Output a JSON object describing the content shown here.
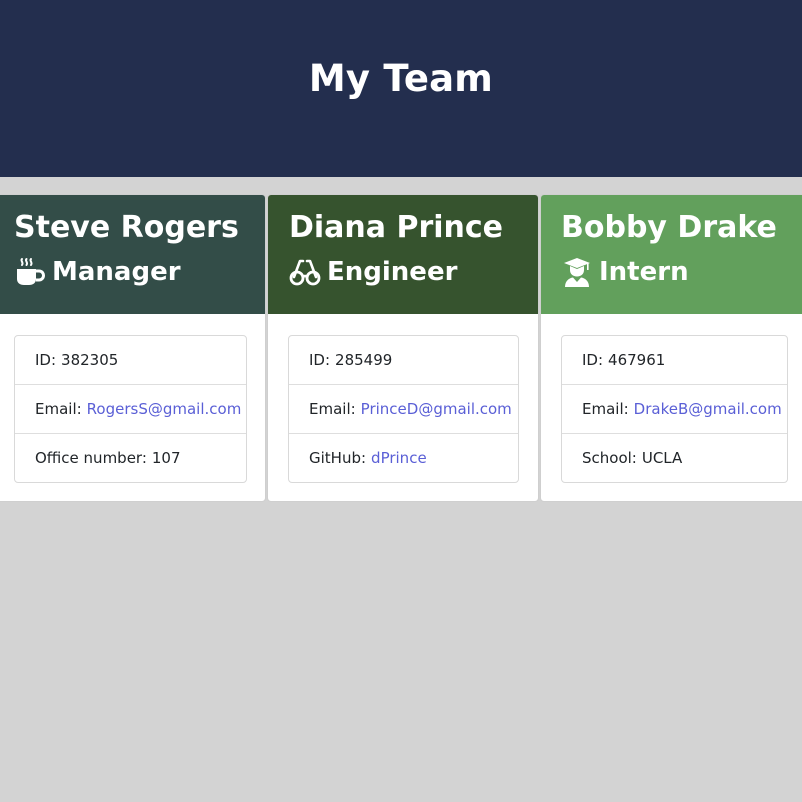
{
  "header": {
    "title": "My Team"
  },
  "colors": {
    "header_bg": "#232e4e",
    "page_bg": "#d3d3d3",
    "manager_bg": "#334d48",
    "engineer_bg": "#36532e",
    "intern_bg": "#62a05c",
    "link": "#5a5fd6"
  },
  "cards": [
    {
      "name": "Steve Rogers",
      "role": "Manager",
      "icon": "coffee-mug-icon",
      "id_label": "ID:",
      "id_value": "382305",
      "email_label": "Email:",
      "email_value": "RogersS@gmail.com",
      "extra_label": "Office number:",
      "extra_value": "107"
    },
    {
      "name": "Diana Prince",
      "role": "Engineer",
      "icon": "glasses-icon",
      "id_label": "ID:",
      "id_value": "285499",
      "email_label": "Email:",
      "email_value": "PrinceD@gmail.com",
      "extra_label": "GitHub:",
      "extra_value": "dPrince"
    },
    {
      "name": "Bobby Drake",
      "role": "Intern",
      "icon": "graduate-icon",
      "id_label": "ID:",
      "id_value": "467961",
      "email_label": "Email:",
      "email_value": "DrakeB@gmail.com",
      "extra_label": "School:",
      "extra_value": "UCLA"
    }
  ]
}
